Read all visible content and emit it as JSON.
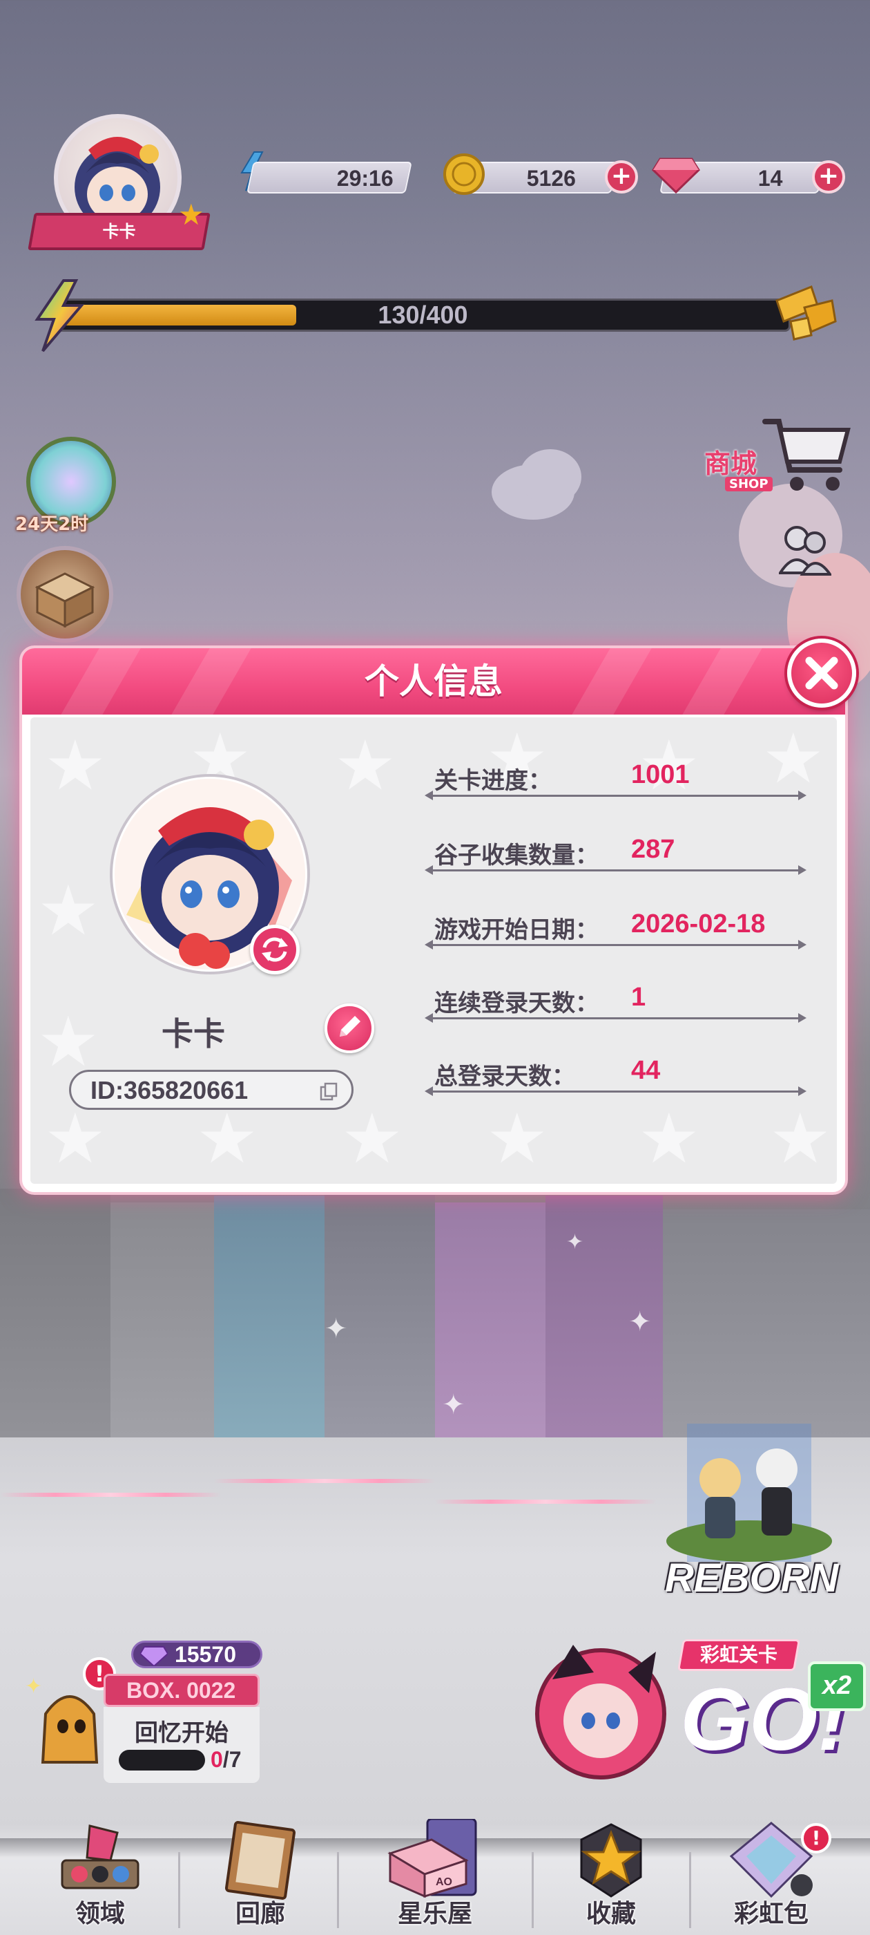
{
  "player": {
    "name": "卡卡",
    "energy_timer": "29:16",
    "coins": "5126",
    "gems": "14"
  },
  "progress": {
    "text": "130/400",
    "fraction": 0.325
  },
  "left_widgets": {
    "event_timer": "24天2时"
  },
  "shop": {
    "label": "商城",
    "sub_label": "SHOP"
  },
  "modal": {
    "title": "个人信息",
    "profile": {
      "name": "卡卡",
      "id": "ID:365820661"
    },
    "info": [
      {
        "label": "关卡进度：",
        "value": "1001"
      },
      {
        "label": "谷子收集数量：",
        "value": "287"
      },
      {
        "label": "游戏开始日期：",
        "value": "2026-02-18"
      },
      {
        "label": "连续登录天数：",
        "value": "1"
      },
      {
        "label": "总登录天数：",
        "value": "44"
      }
    ]
  },
  "reborn": {
    "label": "REBORN"
  },
  "box": {
    "gems": "15570",
    "title": "BOX. 0022",
    "subtitle": "回忆开始",
    "progress_done": "0",
    "progress_total": "/7"
  },
  "rainbow": {
    "label": "彩虹关卡",
    "go": "GO!",
    "multiplier": "x2"
  },
  "nav": [
    {
      "label": "领域"
    },
    {
      "label": "回廊"
    },
    {
      "label": "星乐屋"
    },
    {
      "label": "收藏"
    },
    {
      "label": "彩虹包"
    }
  ],
  "colors": {
    "accent_pink": "#e2245f",
    "header_pink": "#f24b80",
    "text_dark": "#4b4452"
  }
}
